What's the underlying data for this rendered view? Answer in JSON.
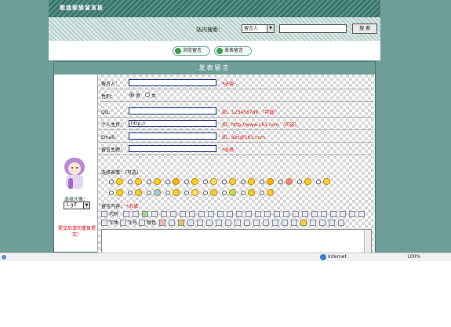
{
  "banner": {
    "title": "歌迷家族留言板"
  },
  "search": {
    "label": "站内搜索：",
    "select_value": "留言人",
    "input_value": "",
    "button_label": "搜 索"
  },
  "nav": {
    "buttons": [
      {
        "label": "浏览留言"
      },
      {
        "label": "发表留言"
      }
    ]
  },
  "panel": {
    "title": "发表留言"
  },
  "avatar": {
    "label": "选择头像：",
    "select_value": "1.gif"
  },
  "left_note": "提交后请勿重复提交！",
  "form": {
    "fields": [
      {
        "label": "留言人：",
        "value": "",
        "hint": "*必填"
      },
      {
        "label": "性别：",
        "value": "",
        "hint": ""
      },
      {
        "label": "QQ：",
        "value": "",
        "hint": "如：123456789 （可选）"
      },
      {
        "label": "个人主页：",
        "value": "http://",
        "hint": "如：http://www.163.com （可选）"
      },
      {
        "label": "Email：",
        "value": "",
        "hint": "如：abc@163.com"
      },
      {
        "label": "留言主题：",
        "value": "",
        "hint": "*必填"
      }
    ],
    "gender_options": [
      "男",
      "女"
    ],
    "emoticon_label": "选择表情：（可选）",
    "content_label": "留言内容：",
    "content_hint": "*必填"
  },
  "toolbar": {
    "row1_label": "代码",
    "row2_labels": [
      "字体",
      "字号",
      "颜色"
    ]
  },
  "statusbar": {
    "zone": "Internet",
    "zoom": "100%"
  },
  "colors": {
    "teal": "#6f9e98",
    "red_hint": "#e01010"
  }
}
